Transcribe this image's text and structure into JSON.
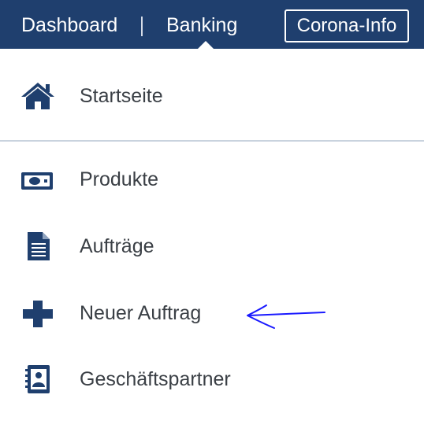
{
  "header": {
    "nav": {
      "dashboard": "Dashboard",
      "banking": "Banking"
    },
    "corona_button": "Corona-Info"
  },
  "menu": {
    "items": [
      {
        "label": "Startseite",
        "icon": "home-icon"
      },
      {
        "label": "Produkte",
        "icon": "banknote-icon"
      },
      {
        "label": "Aufträge",
        "icon": "document-icon"
      },
      {
        "label": "Neuer Auftrag",
        "icon": "plus-icon"
      },
      {
        "label": "Geschäftspartner",
        "icon": "address-book-icon"
      }
    ]
  },
  "colors": {
    "header_bg": "#1f3f6e",
    "icon": "#1f3f6e",
    "text": "#3a3f45",
    "annotation_arrow": "#1a1aff"
  }
}
